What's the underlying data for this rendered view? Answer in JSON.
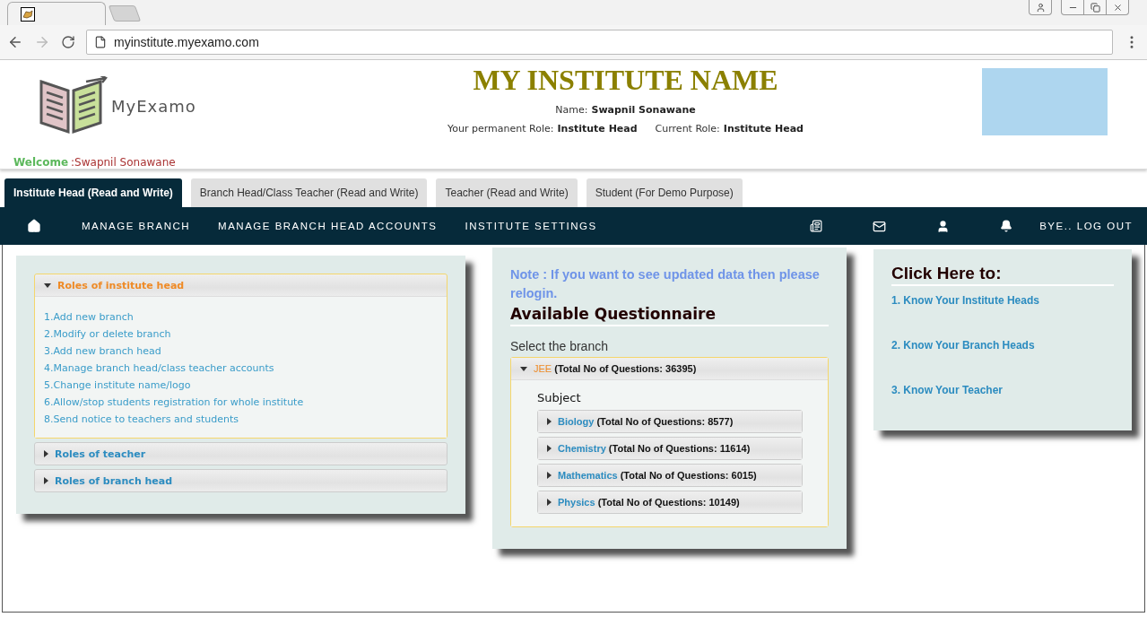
{
  "browser": {
    "url": "myinstitute.myexamo.com"
  },
  "header": {
    "logo_text": "MyExamo",
    "institute_name": "MY INSTITUTE NAME",
    "name_label": "Name:",
    "name_value": "Swapnil Sonawane",
    "permanent_role_label": "Your permanent Role:",
    "permanent_role_value": "Institute Head",
    "current_role_label": "Current Role:",
    "current_role_value": "Institute Head"
  },
  "welcome": {
    "label": "Welcome",
    "name": ":Swapnil Sonawane"
  },
  "role_tabs": [
    {
      "label": "Institute Head (Read and Write)",
      "selected": true
    },
    {
      "label": "Branch Head/Class Teacher (Read and Write)",
      "selected": false
    },
    {
      "label": "Teacher (Read and Write)",
      "selected": false
    },
    {
      "label": "Student (For Demo Purpose)",
      "selected": false
    }
  ],
  "nav": {
    "links": [
      "MANAGE BRANCH",
      "MANAGE BRANCH HEAD ACCOUNTS",
      "INSTITUTE SETTINGS"
    ],
    "logout": "BYE.. LOG OUT"
  },
  "roles_panel": {
    "sections": [
      {
        "title": "Roles of institute head",
        "expanded": true,
        "items": [
          "1.Add new branch",
          "2.Modify or delete branch",
          "3.Add new branch head",
          "4.Manage branch head/class teacher accounts",
          "5.Change institute name/logo",
          "6.Allow/stop students registration for whole institute",
          "8.Send notice to teachers and students"
        ]
      },
      {
        "title": "Roles of teacher",
        "expanded": false
      },
      {
        "title": "Roles of branch head",
        "expanded": false
      }
    ]
  },
  "questionnaire": {
    "note": "Note : If you want to see updated data then please relogin.",
    "title": "Available Questionnaire",
    "select_label": "Select the branch",
    "branches": [
      {
        "name": "JEE",
        "total": "(Total No of Questions: 36395)",
        "expanded": true,
        "subject_label": "Subject",
        "subjects": [
          {
            "name": "Biology",
            "total": "(Total No of Questions: 8577)",
            "expanded": false
          },
          {
            "name": "Chemistry",
            "total": "(Total No of Questions: 11614)",
            "expanded": false
          },
          {
            "name": "Mathematics",
            "total": "(Total No of Questions: 6015)",
            "expanded": false
          },
          {
            "name": "Physics",
            "total": "(Total No of Questions: 10149)",
            "expanded": false
          }
        ]
      }
    ]
  },
  "click_here": {
    "title": "Click Here to:",
    "links": [
      "1. Know Your Institute Heads",
      "2. Know Your Branch Heads",
      "3. Know Your Teacher"
    ]
  }
}
